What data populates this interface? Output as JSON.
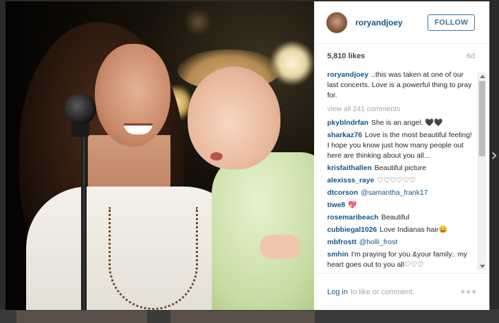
{
  "post": {
    "username": "roryandjoey",
    "follow_label": "FOLLOW",
    "likes": "5,810 likes",
    "age": "6d",
    "caption_user": "roryandjoey",
    "caption_text": "..this was taken at one of our last concerts. Love is a powerful thing to pray for.",
    "view_all": "view all 241 comments"
  },
  "comments": [
    {
      "user": "pkyblndrfan",
      "text": "She is an angel. 🖤🖤",
      "mention": ""
    },
    {
      "user": "sharkaz76",
      "text": "Love is the most beautiful feeling! I hope you know just how many people out here are thinking about you all...",
      "mention": ""
    },
    {
      "user": "krisfaithallen",
      "text": "Beautiful picture",
      "mention": ""
    },
    {
      "user": "alexisss_raye",
      "text": "♡♡♡♡♡♡",
      "mention": ""
    },
    {
      "user": "dtcorson",
      "text": "",
      "mention": "@samantha_frank17"
    },
    {
      "user": "tiwe8",
      "text": "💖",
      "mention": ""
    },
    {
      "user": "rosemaribeach",
      "text": "Beautiful",
      "mention": ""
    },
    {
      "user": "cubbiegal1026",
      "text": "Love Indianas hair😀",
      "mention": ""
    },
    {
      "user": "mbfrostt",
      "text": "",
      "mention": "@holli_frost"
    },
    {
      "user": "smhin",
      "text": "I'm praying for you &your family.. my heart goes out to you all♡♡♡",
      "mention": ""
    }
  ],
  "footer": {
    "login_link": "Log in",
    "login_rest": "to like or comment."
  },
  "icons": {
    "next": "chevron-right-icon",
    "more": "more-options-icon"
  },
  "colors": {
    "link_blue": "#125688",
    "follow_blue": "#3f729b",
    "muted": "#a5a7aa"
  }
}
